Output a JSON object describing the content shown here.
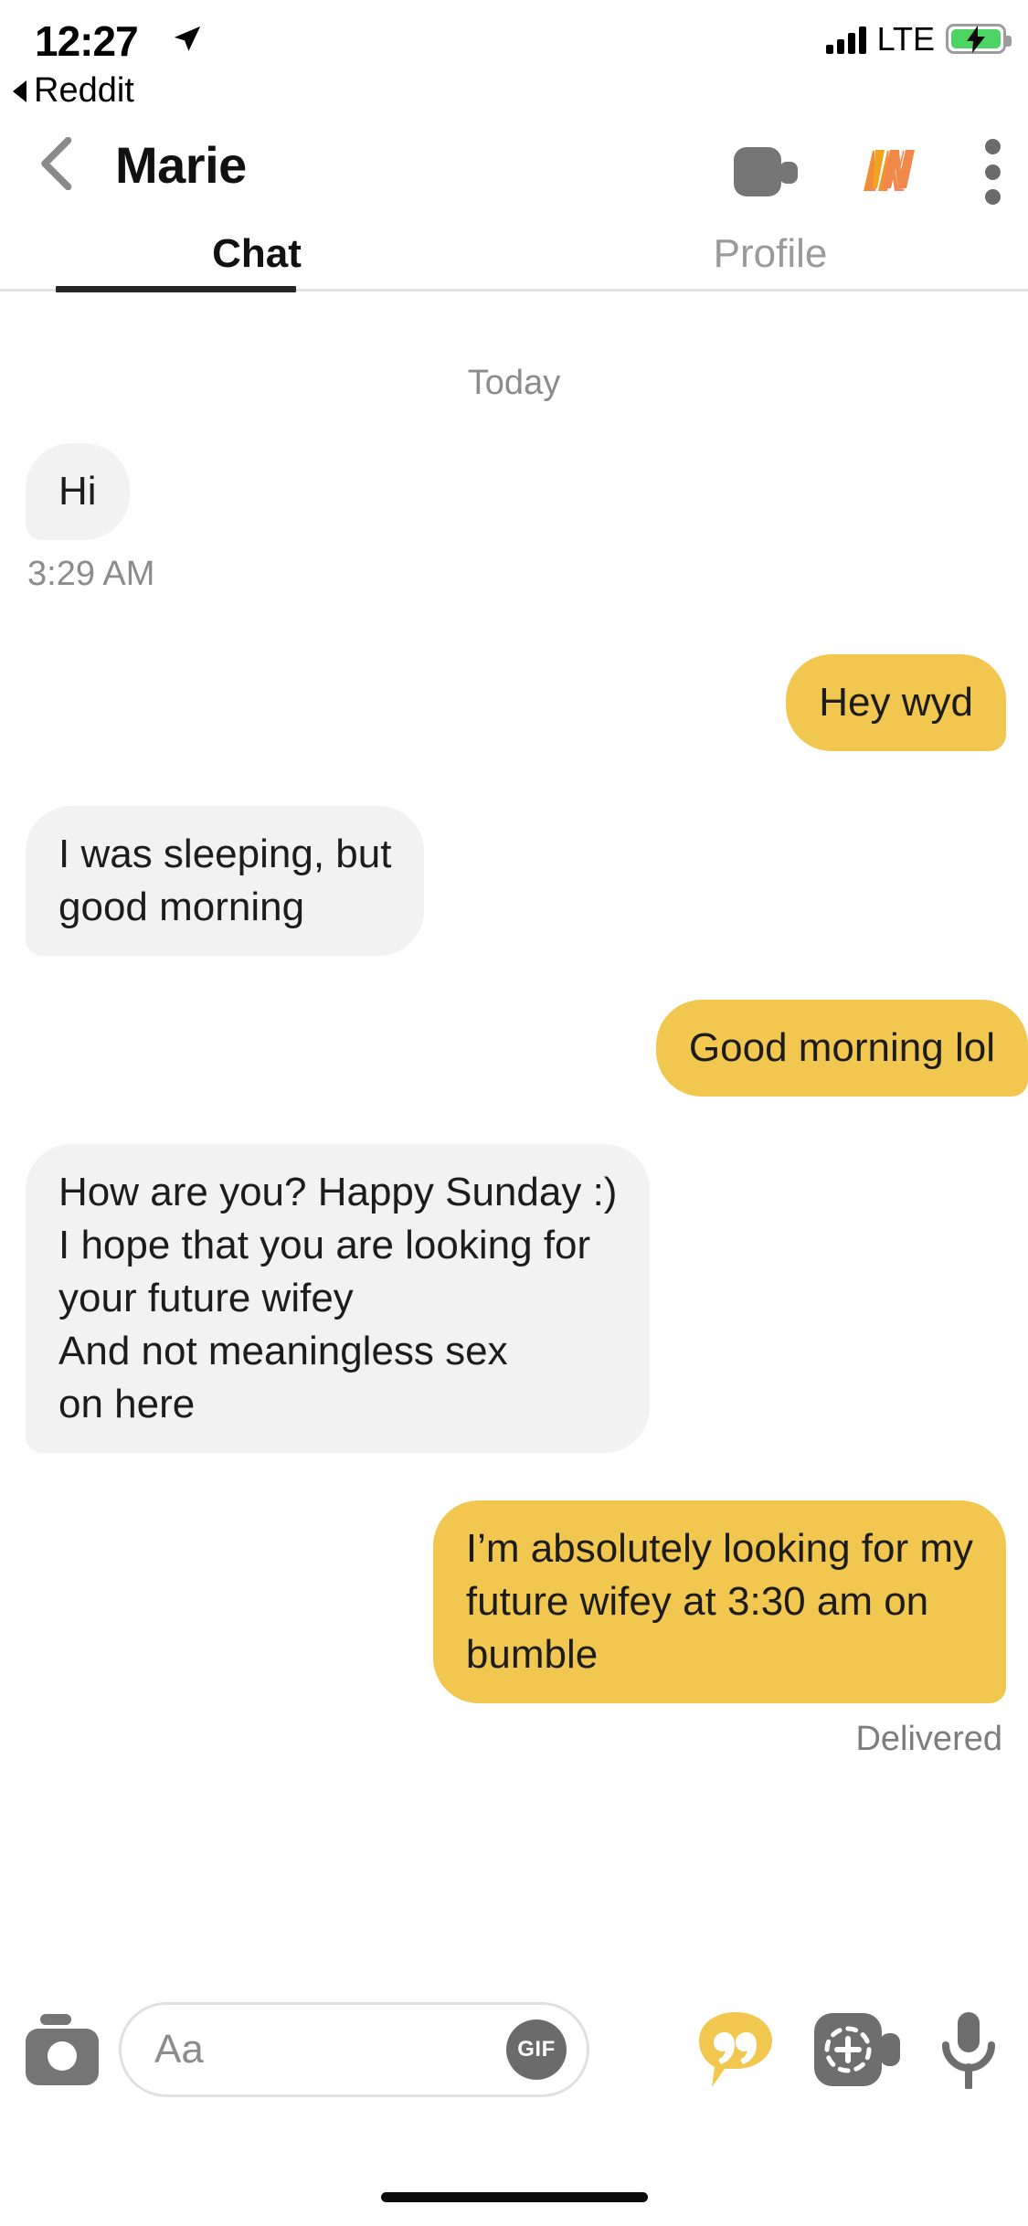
{
  "status_bar": {
    "time": "12:27",
    "location_icon": "location-arrow-icon",
    "back_app_label": "Reddit",
    "network": "LTE",
    "signal_icon": "signal-bars-icon",
    "battery_icon": "battery-charging-icon",
    "battery_color": "#4CD562"
  },
  "nav_header": {
    "back_icon": "back-chevron-icon",
    "peer_name": "Marie",
    "video_call_icon": "video-camera-icon",
    "in_logo_icon": "bumble-in-logo-icon",
    "overflow_icon": "kebab-menu-icon"
  },
  "tabs": {
    "active": "Chat",
    "items": [
      {
        "label": "Chat",
        "active": true
      },
      {
        "label": "Profile",
        "active": false
      }
    ]
  },
  "conversation": {
    "day_separator": "Today",
    "accent_color": "#F2C74F",
    "incoming_color": "#F2F2F2",
    "messages": [
      {
        "direction": "in",
        "text": "Hi",
        "time": "3:29 AM"
      },
      {
        "direction": "out",
        "text": "Hey wyd"
      },
      {
        "direction": "in",
        "text": "I was sleeping, but\ngood morning"
      },
      {
        "direction": "out",
        "text": "Good morning lol"
      },
      {
        "direction": "in",
        "text": "How are you? Happy Sunday :)\nI hope that you are looking for\nyour future wifey\nAnd not meaningless sex\non here"
      },
      {
        "direction": "out",
        "text": "I’m absolutely looking for my\nfuture wifey at 3:30 am on\nbumble",
        "status": "Delivered"
      }
    ]
  },
  "composer": {
    "camera_icon": "camera-icon",
    "input_placeholder": "Aa",
    "input_value": "",
    "gif_label": "GIF",
    "quote_icon": "quote-bubble-icon",
    "effects_icon": "effects-camera-icon",
    "mic_icon": "microphone-icon"
  },
  "home_indicator": "home-indicator-bar"
}
